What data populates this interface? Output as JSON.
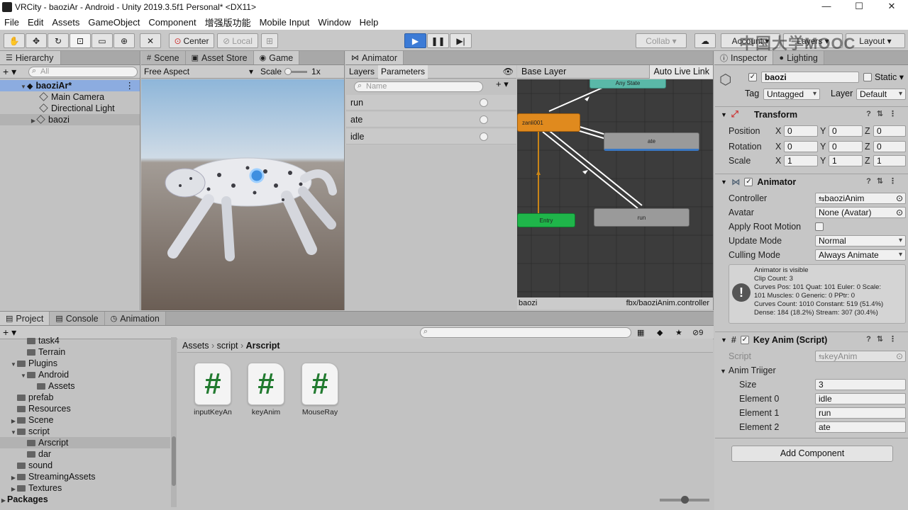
{
  "window": {
    "title": "VRCity - baoziAr - Android - Unity 2019.3.5f1 Personal* <DX11>"
  },
  "menu": [
    "File",
    "Edit",
    "Assets",
    "GameObject",
    "Component",
    "增强版功能",
    "Mobile Input",
    "Window",
    "Help"
  ],
  "toolbar": {
    "pivot_label": "Center",
    "space_label": "Local",
    "collab_label": "Collab ▾",
    "account_label": "Account ▾",
    "layers_label": "Layers ▾",
    "layout_label": "Layout ▾",
    "play_icon": "play-icon",
    "watermark": "中国大学MOOC"
  },
  "hierarchy": {
    "tab": "Hierarchy",
    "search_placeholder": "All",
    "scene": "baoziAr*",
    "items": [
      "Main Camera",
      "Directional Light",
      "baozi"
    ]
  },
  "game": {
    "tabs": [
      "Scene",
      "Asset Store",
      "Game"
    ],
    "aspect": "Free Aspect",
    "scale_label": "Scale",
    "scale_value": "1x"
  },
  "animator": {
    "tab": "Animator",
    "subtabs": [
      "Layers",
      "Parameters"
    ],
    "search_placeholder": "Name",
    "parameters": [
      "run",
      "ate",
      "idle"
    ],
    "layer": "Base Layer",
    "live_link": "Auto Live Link",
    "states": {
      "any": "Any State",
      "current": "zanli001",
      "ate": "ate",
      "entry": "Entry",
      "run": "run"
    },
    "footer_left": "baozi",
    "footer_right": "fbx/baoziAnim.controller"
  },
  "project": {
    "tabs": [
      "Project",
      "Console",
      "Animation"
    ],
    "hidden_count": "9",
    "tree": [
      "task4",
      "Terrain",
      "Plugins",
      "Android",
      "Assets",
      "prefab",
      "Resources",
      "Scene",
      "script",
      "Arscript",
      "dar",
      "sound",
      "StreamingAssets",
      "Textures",
      "Packages"
    ],
    "breadcrumb": [
      "Assets",
      "script",
      "Arscript"
    ],
    "assets": [
      {
        "name": "inputKeyAn",
        "glyph": "#"
      },
      {
        "name": "keyAnim",
        "glyph": "#"
      },
      {
        "name": "MouseRay",
        "glyph": "#"
      }
    ]
  },
  "inspector": {
    "tabs": [
      "Inspector",
      "Lighting"
    ],
    "object_name": "baozi",
    "static_label": "Static ▾",
    "tag_label": "Tag",
    "tag_value": "Untagged",
    "layer_label": "Layer",
    "layer_value": "Default",
    "transform": {
      "title": "Transform",
      "rows": [
        {
          "label": "Position",
          "x": "0",
          "y": "0",
          "z": "0"
        },
        {
          "label": "Rotation",
          "x": "0",
          "y": "0",
          "z": "0"
        },
        {
          "label": "Scale",
          "x": "1",
          "y": "1",
          "z": "1"
        }
      ],
      "axis": [
        "X",
        "Y",
        "Z"
      ]
    },
    "animator": {
      "title": "Animator",
      "rows": [
        {
          "label": "Controller",
          "value": "baoziAnim"
        },
        {
          "label": "Avatar",
          "value": "None (Avatar)"
        },
        {
          "label": "Apply Root Motion",
          "value": ""
        },
        {
          "label": "Update Mode",
          "value": "Normal"
        },
        {
          "label": "Culling Mode",
          "value": "Always Animate"
        }
      ],
      "info": [
        "Animator is visible",
        "Clip Count: 3",
        "Curves Pos: 101 Quat: 101 Euler: 0 Scale:",
        "101 Muscles: 0 Generic: 0 PPtr: 0",
        "Curves Count: 1010 Constant: 519 (51.4%)",
        "Dense: 184 (18.2%) Stream: 307 (30.4%)"
      ]
    },
    "keyanim": {
      "title": "Key Anim (Script)",
      "script_label": "Script",
      "script_value": "keyAnim",
      "array_label": "Anim Triiger",
      "size_label": "Size",
      "size_value": "3",
      "elements": [
        {
          "label": "Element 0",
          "value": "idle"
        },
        {
          "label": "Element 1",
          "value": "run"
        },
        {
          "label": "Element 2",
          "value": "ate"
        }
      ]
    },
    "add_component": "Add Component"
  },
  "colors": {
    "selection": "#8cace0",
    "play": "#3c7bd6",
    "state_orange": "#e08a1e",
    "state_green": "#1fb54a",
    "state_teal": "#5ab8a8",
    "graph_bg": "#3c3c3c"
  }
}
